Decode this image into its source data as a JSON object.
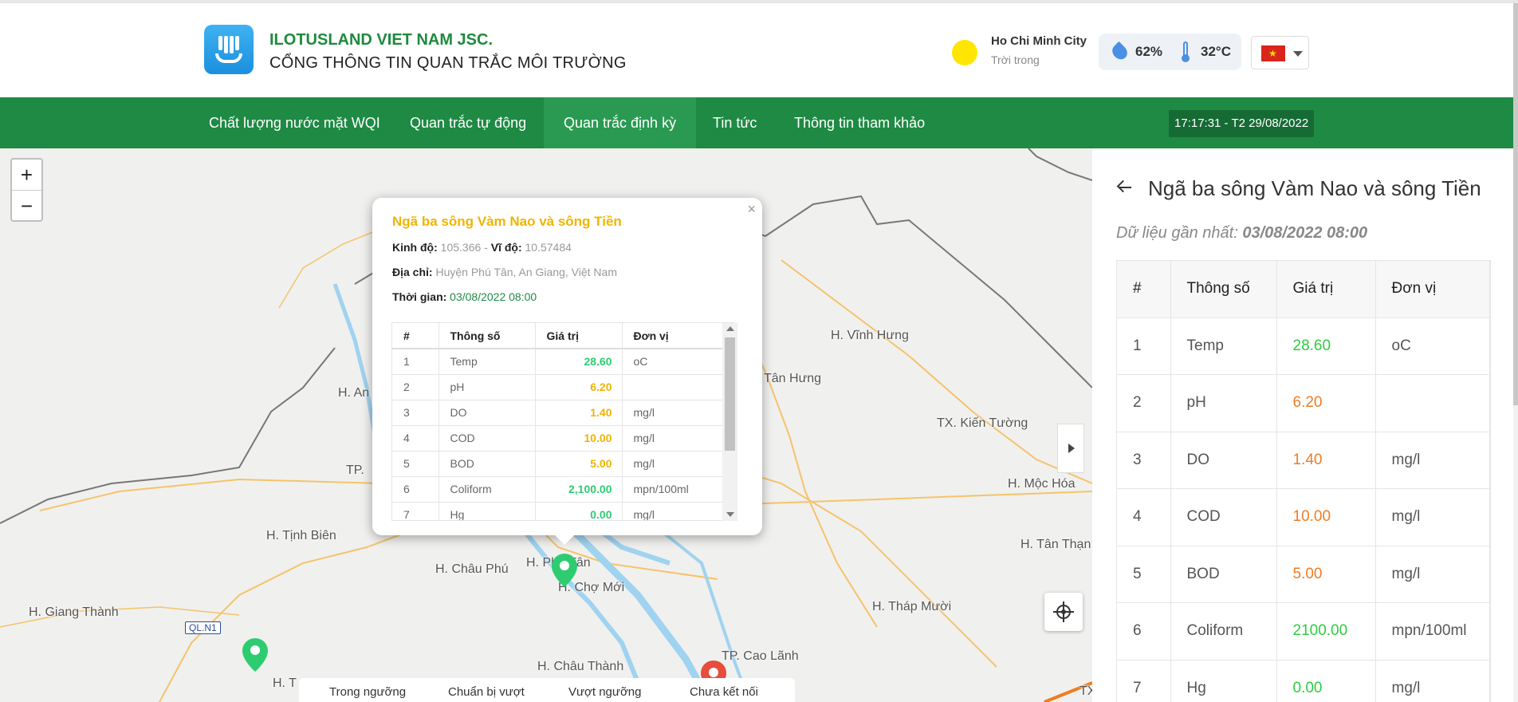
{
  "header": {
    "company": "ILOTUSLAND VIET NAM JSC.",
    "portal": "CỔNG THÔNG TIN QUAN TRẮC MÔI TRƯỜNG",
    "weather": {
      "city": "Ho Chi Minh City",
      "condition": "Trời trong",
      "humidity": "62%",
      "temperature": "32°C"
    },
    "language_flag": "vn-flag"
  },
  "nav": {
    "items": [
      {
        "label": "Chất lượng nước mặt WQI"
      },
      {
        "label": "Quan trắc tự động"
      },
      {
        "label": "Quan trắc định kỳ"
      },
      {
        "label": "Tin tức"
      },
      {
        "label": "Thông tin tham khảo"
      }
    ],
    "active_index": 2,
    "clock": "17:17:31 - T2 29/08/2022"
  },
  "map": {
    "zoom_in": "+",
    "zoom_out": "−",
    "places": [
      "H. Vĩnh Hưng",
      "Tân Hưng",
      "TX. Kiến Tường",
      "H. Mộc Hóa",
      "H. Tân Thạn",
      "H. An",
      "TP.",
      "H. Tịnh Biên",
      "H. Châu Phú",
      "H. Phú Tân",
      "H. Chợ Mới",
      "H. Giang Thành",
      "H. Tháp Mười",
      "TP. Cao Lãnh",
      "H. Châu Thành",
      "H. T",
      "TX"
    ],
    "road_shield": "QL.N1",
    "legend": [
      "Trong ngưỡng",
      "Chuẩn bị vượt",
      "Vượt ngưỡng",
      "Chưa kết nối"
    ],
    "colors": {
      "green": "#2ecc71",
      "red": "#e74c3c",
      "river": "#9fd3f0",
      "road": "#f5c36b"
    }
  },
  "popup": {
    "title": "Ngã ba sông Vàm Nao và sông Tiền",
    "lng_label": "Kinh độ:",
    "lng": "105.366",
    "sep": " - ",
    "lat_label": "Vĩ độ:",
    "lat": "10.57484",
    "address_label": "Địa chỉ:",
    "address": "Huyện Phú Tân, An Giang, Việt Nam",
    "time_label": "Thời gian:",
    "time": "03/08/2022 08:00",
    "close": "×",
    "columns": [
      "#",
      "Thông số",
      "Giá trị",
      "Đơn vị"
    ],
    "rows": [
      {
        "no": "1",
        "param": "Temp",
        "value": "28.60",
        "unit": "oC",
        "color": "#2ecc71"
      },
      {
        "no": "2",
        "param": "pH",
        "value": "6.20",
        "unit": "",
        "color": "#f0b400"
      },
      {
        "no": "3",
        "param": "DO",
        "value": "1.40",
        "unit": "mg/l",
        "color": "#f0b400"
      },
      {
        "no": "4",
        "param": "COD",
        "value": "10.00",
        "unit": "mg/l",
        "color": "#f0b400"
      },
      {
        "no": "5",
        "param": "BOD",
        "value": "5.00",
        "unit": "mg/l",
        "color": "#f0b400"
      },
      {
        "no": "6",
        "param": "Coliform",
        "value": "2,100.00",
        "unit": "mpn/100ml",
        "color": "#2ecc71"
      },
      {
        "no": "7",
        "param": "Hg",
        "value": "0.00",
        "unit": "mg/l",
        "color": "#2ecc71"
      }
    ]
  },
  "panel": {
    "title": "Ngã ba sông Vàm Nao và sông Tiền",
    "latest_label": "Dữ liệu gần nhất:",
    "latest_time": "03/08/2022 08:00",
    "columns": [
      "#",
      "Thông số",
      "Giá trị",
      "Đơn vị"
    ],
    "rows": [
      {
        "no": "1",
        "param": "Temp",
        "value": "28.60",
        "unit": "oC",
        "color": "#2ecc40"
      },
      {
        "no": "2",
        "param": "pH",
        "value": "6.20",
        "unit": "",
        "color": "#f07c22"
      },
      {
        "no": "3",
        "param": "DO",
        "value": "1.40",
        "unit": "mg/l",
        "color": "#f07c22"
      },
      {
        "no": "4",
        "param": "COD",
        "value": "10.00",
        "unit": "mg/l",
        "color": "#f07c22"
      },
      {
        "no": "5",
        "param": "BOD",
        "value": "5.00",
        "unit": "mg/l",
        "color": "#f07c22"
      },
      {
        "no": "6",
        "param": "Coliform",
        "value": "2100.00",
        "unit": "mpn/100ml",
        "color": "#2ecc40"
      },
      {
        "no": "7",
        "param": "Hg",
        "value": "0.00",
        "unit": "mg/l",
        "color": "#2ecc40"
      }
    ]
  }
}
